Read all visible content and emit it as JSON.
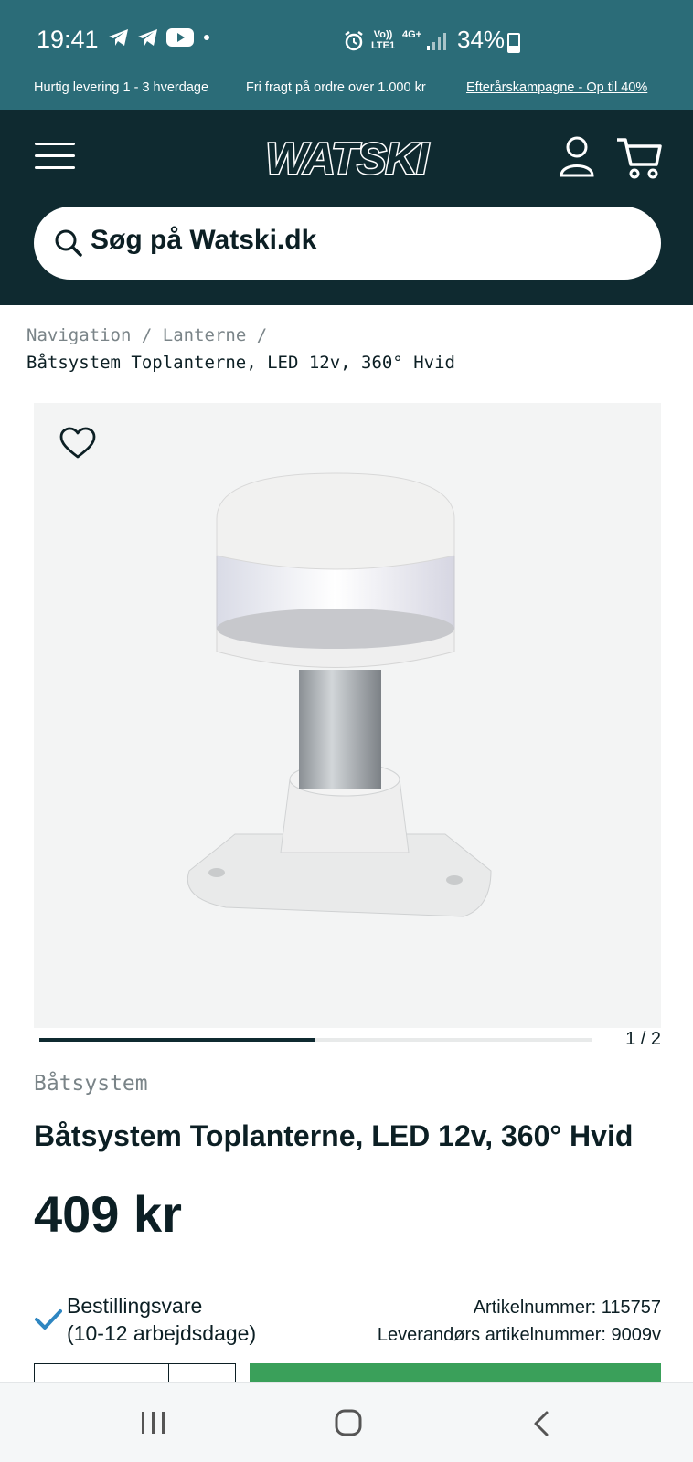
{
  "status_bar": {
    "time": "19:41",
    "network": "LTE1",
    "network_top": "Vo))",
    "signal_type": "4G+",
    "battery": "34%"
  },
  "promo": {
    "item1": "Hurtig levering 1 - 3 hverdage",
    "item2": "Fri fragt på ordre over 1.000 kr",
    "item3": "Efterårskampagne - Op til 40%"
  },
  "header": {
    "logo": "WATSKI",
    "search_placeholder": "Søg på Watski.dk"
  },
  "breadcrumb": {
    "link1": "Navigation",
    "link2": "Lanterne",
    "separator": "/",
    "current": "Båtsystem Toplanterne, LED 12v, 360° Hvid"
  },
  "gallery": {
    "counter": "1 / 2",
    "progress": 0.5
  },
  "product": {
    "brand": "Båtsystem",
    "title": "Båtsystem Toplanterne, LED 12v, 360° Hvid",
    "price": "409 kr",
    "stock_line1": "Bestillingsvare",
    "stock_line2": "(10-12 arbejdsdage)",
    "article_number": "Artikelnummer: 115757",
    "supplier_number": "Leverandørs artikelnummer: 9009v"
  },
  "colors": {
    "teal": "#2b6c78",
    "dark": "#0f2a30",
    "green": "#3aa05a",
    "check": "#2e86c1"
  }
}
